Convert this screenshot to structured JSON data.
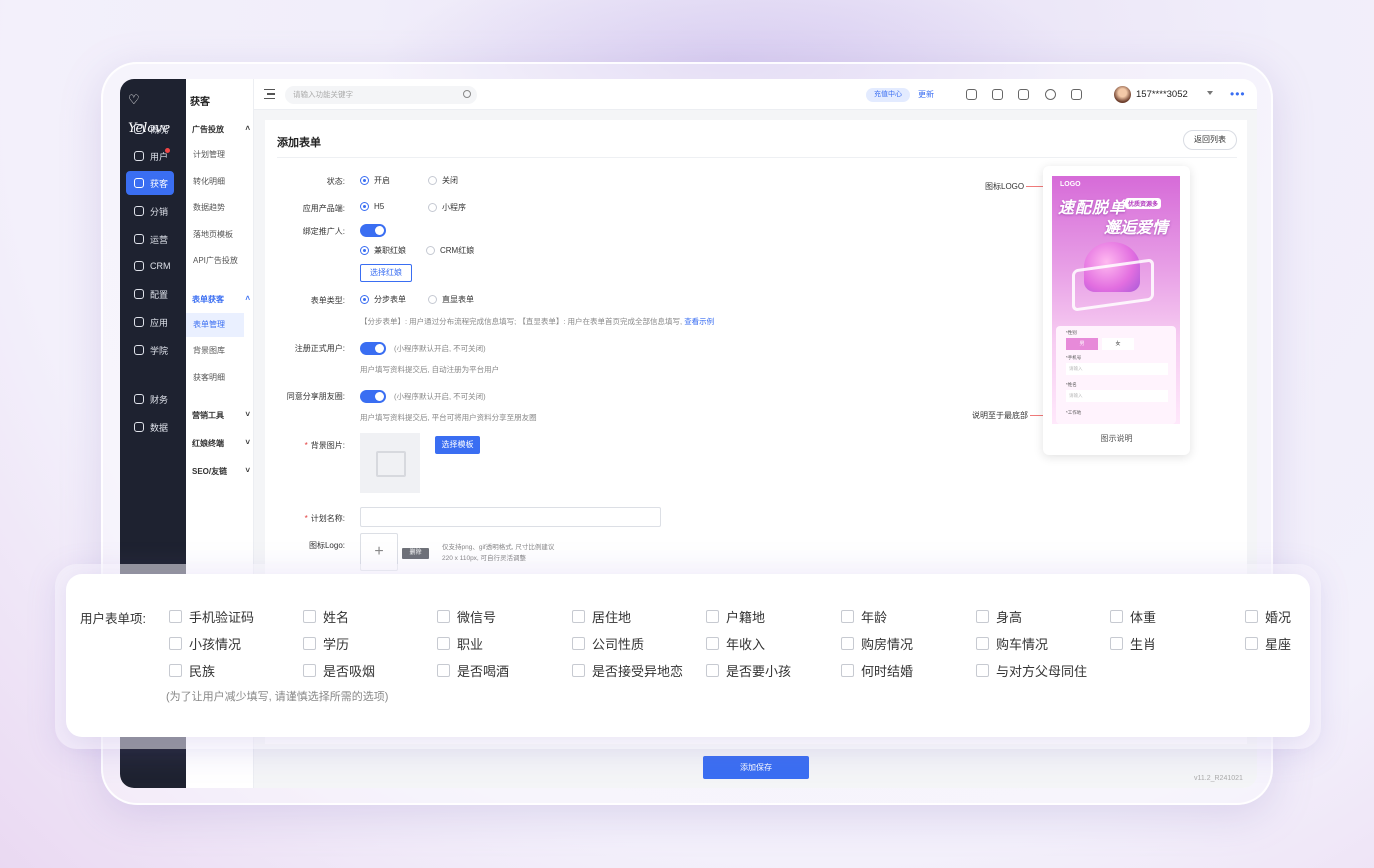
{
  "app": {
    "logo": "Yelove",
    "main_nav": [
      {
        "label": "概况",
        "icon": "overview-icon"
      },
      {
        "label": "用户",
        "icon": "user-icon",
        "badge": true
      },
      {
        "label": "获客",
        "icon": "acquire-icon",
        "active": true
      },
      {
        "label": "分销",
        "icon": "distribute-icon"
      },
      {
        "label": "运营",
        "icon": "operate-icon"
      },
      {
        "label": "CRM",
        "icon": "crm-icon"
      },
      {
        "label": "配置",
        "icon": "config-icon"
      },
      {
        "label": "应用",
        "icon": "apps-icon"
      },
      {
        "label": "学院",
        "icon": "academy-icon"
      },
      {
        "label": "财务",
        "icon": "finance-icon"
      },
      {
        "label": "数据",
        "icon": "data-icon"
      }
    ],
    "sub_nav": {
      "title": "获客",
      "groups": [
        {
          "label": "广告投放",
          "items": [
            "计划管理",
            "转化明细",
            "数据趋势",
            "落地页模板",
            "API广告投放"
          ]
        },
        {
          "label": "表单获客",
          "items": [
            "表单管理",
            "背景图库",
            "获客明细"
          ],
          "active_item": "表单管理"
        },
        {
          "label": "营销工具"
        },
        {
          "label": "红娘终端"
        },
        {
          "label": "SEO/友链"
        }
      ]
    }
  },
  "topbar": {
    "search_placeholder": "请输入功能关键字",
    "recharge": "充值中心",
    "update": "更新",
    "username": "157****3052"
  },
  "form": {
    "title": "添加表单",
    "back_label": "返回列表",
    "status": {
      "label": "状态:",
      "options": [
        "开启",
        "关闭"
      ],
      "selected": "开启"
    },
    "product": {
      "label": "应用产品端:",
      "options": [
        "H5",
        "小程序"
      ],
      "selected": "H5"
    },
    "promoter": {
      "label": "绑定推广人:",
      "options": [
        "兼职红娘",
        "CRM红娘"
      ],
      "selected": "兼职红娘",
      "button": "选择红娘",
      "enabled": true
    },
    "form_type": {
      "label": "表单类型:",
      "options": [
        "分步表单",
        "直显表单"
      ],
      "selected": "分步表单",
      "hint": "【分步表单】: 用户通过分布流程完成信息填写; 【直显表单】: 用户在表单首页完成全部信息填写,",
      "hint_link": "查看示例"
    },
    "register": {
      "label": "注册正式用户:",
      "note": "(小程序默认开启, 不可关闭)",
      "hint": "用户填写资料提交后, 自动注册为平台用户",
      "enabled": true
    },
    "share": {
      "label": "同意分享朋友圈:",
      "note": "(小程序默认开启, 不可关闭)",
      "hint": "用户填写资料提交后, 平台可将用户资料分享至朋友圈",
      "enabled": true
    },
    "background": {
      "label": "背景图片:",
      "button": "选择模板"
    },
    "plan_name": {
      "label": "计划名称:",
      "value": ""
    },
    "icon_logo": {
      "label": "图标Logo:",
      "delete": "删除",
      "hint1": "仅支持png、gif透明格式, 尺寸比例建议",
      "hint2": "220 x 110px, 可自行灵活调整"
    },
    "save_label": "添加保存",
    "version": "v11.2_R241021"
  },
  "preview": {
    "caption": "图示说明",
    "anno_logo": "图标LOGO",
    "anno_bottom": "说明至于最底部",
    "phone": {
      "logo": "LOGO",
      "headline1": "速配脱单",
      "headline2": "邂逅爱情",
      "tag": "优质资源多",
      "gender_label": "*性别",
      "male": "男",
      "female": "女",
      "phone_label": "*手机号",
      "phone_ph": "请输入",
      "name_label": "*姓名",
      "name_ph": "请输入",
      "job_label": "*工作地"
    }
  },
  "fields_panel": {
    "label": "用户表单项:",
    "rows": [
      [
        "手机验证码",
        "姓名",
        "微信号",
        "居住地",
        "户籍地",
        "年龄",
        "身高",
        "体重",
        "婚况"
      ],
      [
        "小孩情况",
        "学历",
        "职业",
        "公司性质",
        "年收入",
        "购房情况",
        "购车情况",
        "生肖",
        "星座"
      ],
      [
        "民族",
        "是否吸烟",
        "是否喝酒",
        "是否接受异地恋",
        "是否要小孩",
        "何时结婚",
        "与对方父母同住"
      ]
    ],
    "note": "(为了让用户减少填写, 请谨慎选择所需的选项)"
  }
}
